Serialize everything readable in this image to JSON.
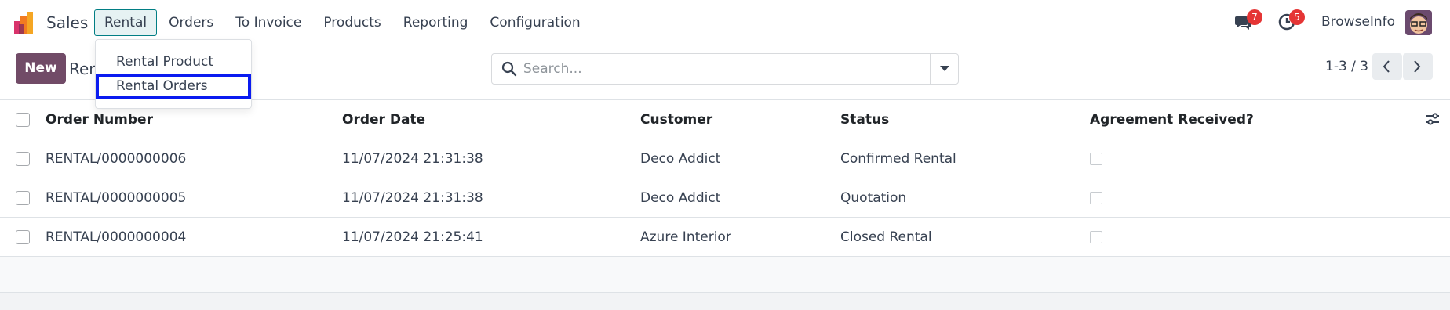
{
  "navbar": {
    "app_name": "Sales",
    "menu": [
      {
        "label": "Rental",
        "active": true
      },
      {
        "label": "Orders"
      },
      {
        "label": "To Invoice"
      },
      {
        "label": "Products"
      },
      {
        "label": "Reporting"
      },
      {
        "label": "Configuration"
      }
    ],
    "messages_badge": "7",
    "activities_badge": "5",
    "user_name": "BrowseInfo",
    "icons": {
      "messages": "chat-icon",
      "activities": "clock-icon",
      "logo": "odoo-logo"
    }
  },
  "rental_menu": {
    "items": [
      {
        "label": "Rental Product"
      },
      {
        "label": "Rental Orders"
      }
    ]
  },
  "control": {
    "new_label": "New",
    "title": "Rental Orders",
    "search_placeholder": "Search...",
    "pager": "1-3 / 3"
  },
  "table": {
    "columns": [
      "Order Number",
      "Order Date",
      "Customer",
      "Status",
      "Agreement Received?"
    ],
    "rows": [
      {
        "number": "RENTAL/0000000006",
        "date": "11/07/2024 21:31:38",
        "customer": "Deco Addict",
        "status": "Confirmed Rental",
        "agreement": false
      },
      {
        "number": "RENTAL/0000000005",
        "date": "11/07/2024 21:31:38",
        "customer": "Deco Addict",
        "status": "Quotation",
        "agreement": false
      },
      {
        "number": "RENTAL/0000000004",
        "date": "11/07/2024 21:25:41",
        "customer": "Azure Interior",
        "status": "Closed Rental",
        "agreement": false
      }
    ]
  },
  "colors": {
    "brand": "#714b67",
    "active_menu": "#017e84",
    "badge": "#e53535",
    "highlight": "#0a1bf0"
  }
}
